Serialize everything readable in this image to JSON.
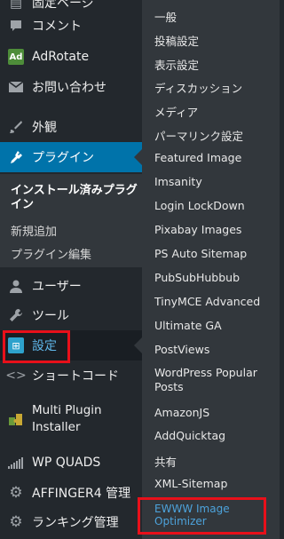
{
  "sidebar": {
    "items": [
      {
        "label": "固定ページ",
        "icon": "page-icon"
      },
      {
        "label": "コメント",
        "icon": "comment-icon"
      },
      {
        "label": "AdRotate",
        "icon": "ad-icon"
      },
      {
        "label": "お問い合わせ",
        "icon": "mail-icon"
      },
      {
        "label": "外観",
        "icon": "brush-icon"
      },
      {
        "label": "プラグイン",
        "icon": "plugin-icon"
      },
      {
        "label": "ユーザー",
        "icon": "user-icon"
      },
      {
        "label": "ツール",
        "icon": "wrench-icon"
      },
      {
        "label": "設定",
        "icon": "settings-icon"
      },
      {
        "label": "ショートコード",
        "icon": "code-icon"
      },
      {
        "label": "Multi Plugin Installer",
        "icon": "puzzle-icon"
      },
      {
        "label": "WP QUADS",
        "icon": "signal-icon"
      },
      {
        "label": "AFFINGER4 管理",
        "icon": "gear-icon"
      },
      {
        "label": "ランキング管理",
        "icon": "gear-icon"
      }
    ],
    "plugin_submenu": [
      "インストール済みプラグイン",
      "新規追加",
      "プラグイン編集"
    ]
  },
  "settings_flyout": {
    "items": [
      "一般",
      "投稿設定",
      "表示設定",
      "ディスカッション",
      "メディア",
      "パーマリンク設定",
      "Featured Image",
      "Imsanity",
      "Login LockDown",
      "Pixabay Images",
      "PS Auto Sitemap",
      "PubSubHubbub",
      "TinyMCE Advanced",
      "Ultimate GA",
      "PostViews",
      "WordPress Popular Posts",
      "AmazonJS",
      "AddQuicktag",
      "共有",
      "XML-Sitemap",
      "EWWW Image Optimizer"
    ]
  },
  "colors": {
    "highlight": "#e8101a",
    "active": "#0073aa",
    "link_blue": "#4da3dc"
  }
}
